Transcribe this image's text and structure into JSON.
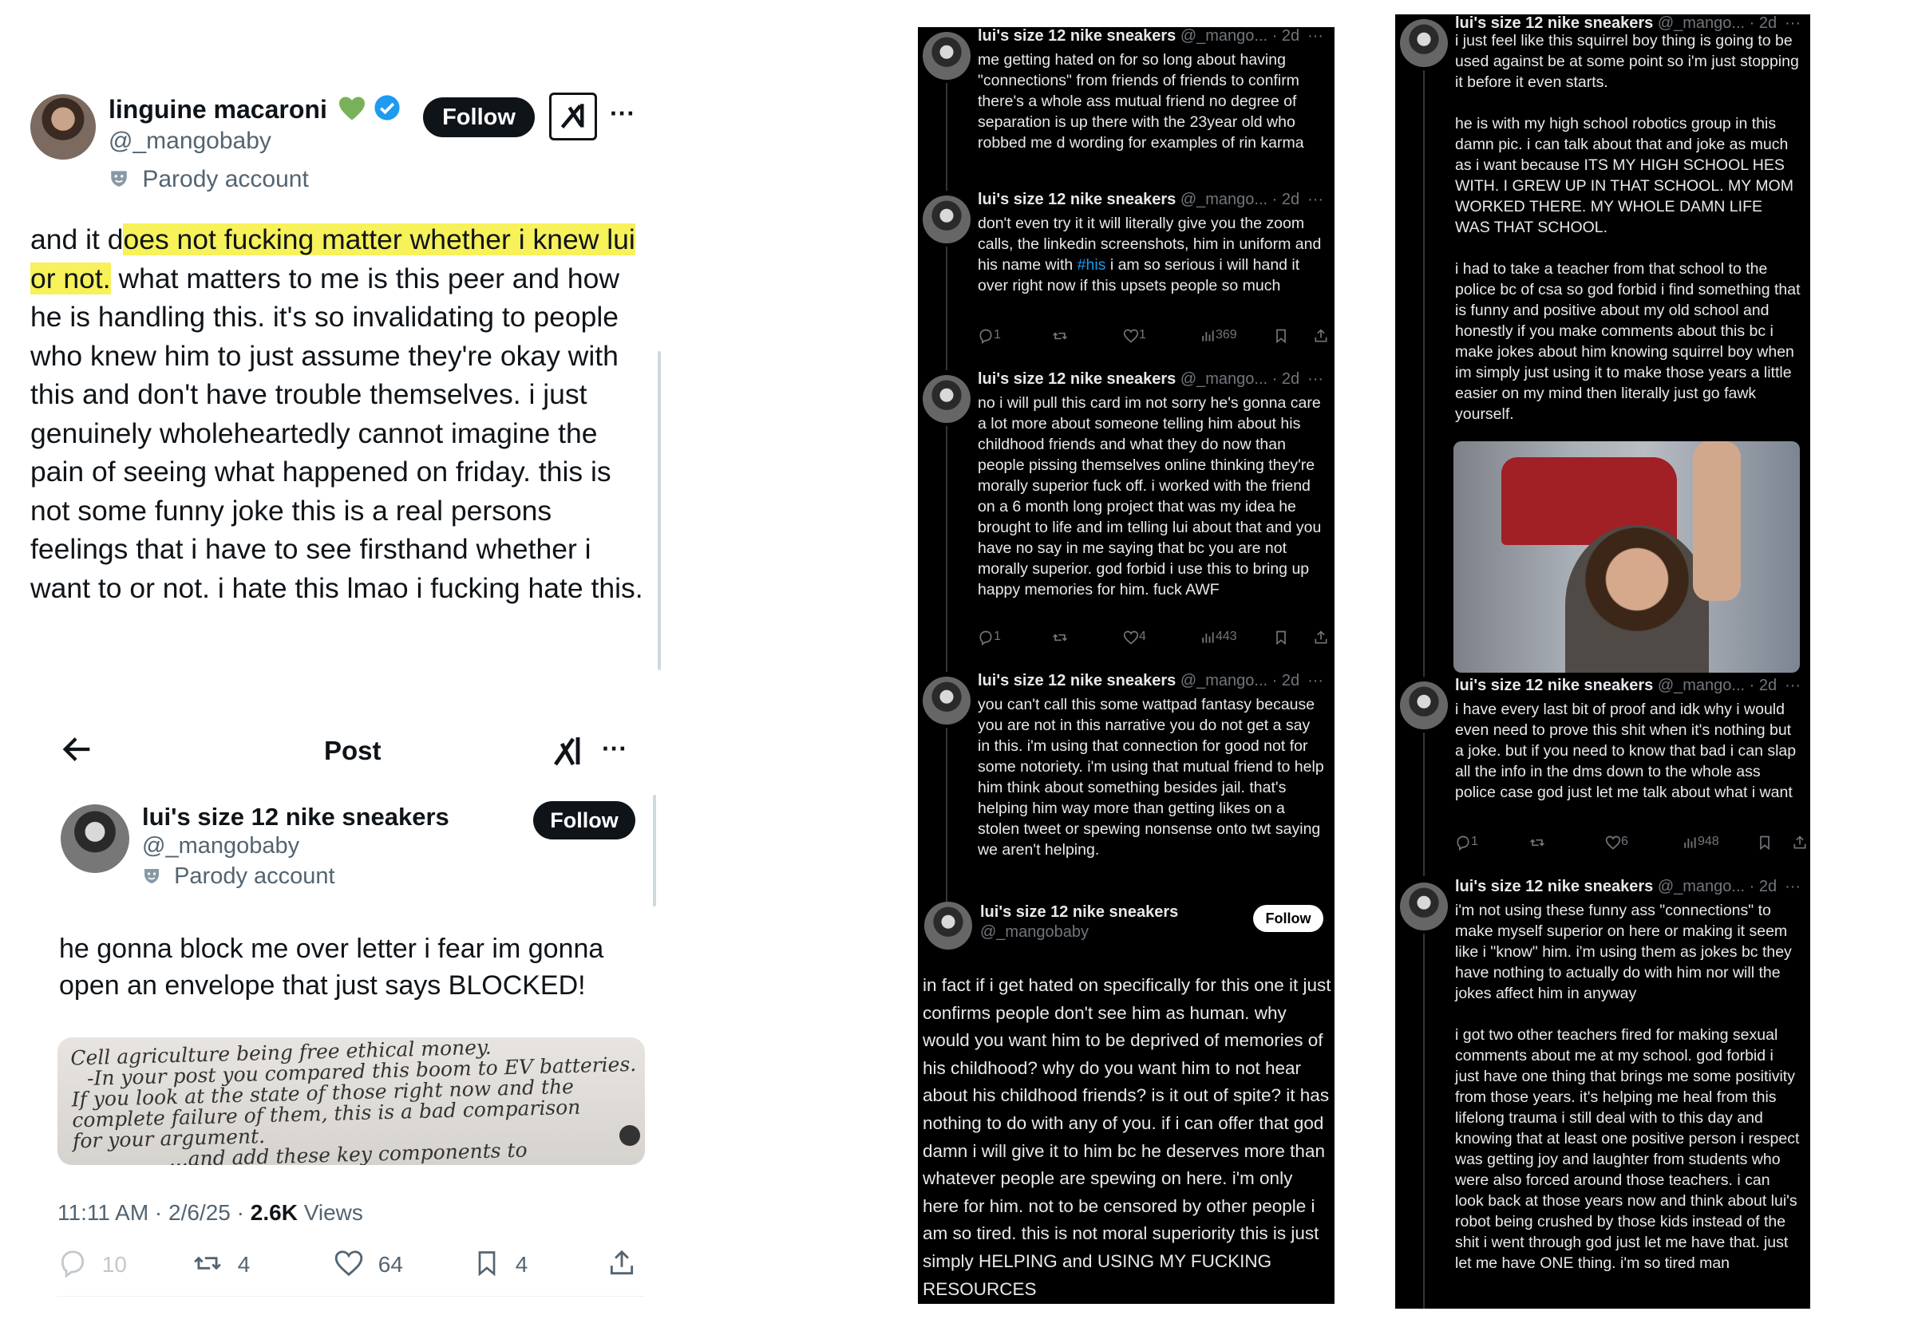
{
  "screenshot1": {
    "display_name": "linguine macaroni",
    "handle": "@_mangobaby",
    "parody_label": "Parody account",
    "follow_label": "Follow",
    "more_label": "···",
    "text_pre": "and it d",
    "text_highlight_1": "oes not fucking matter whether i knew lui",
    "text_highlight_2": "or not.",
    "text_post": " what matters to me is this peer and how he is handling this. it's so invalidating to people who knew him to just assume they're okay with this and don't have trouble themselves. i just genuinely wholeheartedly cannot imagine the pain of seeing what happened on friday. this is not some funny joke this is a real persons feelings that i have to see firsthand whether i want to or not. i hate this lmao i fucking hate this."
  },
  "screenshot2": {
    "header_title": "Post",
    "back_icon": "arrow-left-icon",
    "more_label": "···",
    "display_name": "lui's size 12 nike sneakers",
    "handle": "@_mangobaby",
    "parody_label": "Parody account",
    "follow_label": "Follow",
    "text": "he gonna block me over letter i fear im gonna open an envelope that just says BLOCKED!",
    "letter_lines": [
      "Cell agriculture being free ethical money.",
      "-In your post you compared this boom to EV batteries.",
      "If you look at the state of those right now and the",
      "complete failure of them, this is a bad comparison",
      "for your argument.",
      "...and add these key components to"
    ],
    "timestamp": "11:11 AM · 2/6/25 · ",
    "views_count": "2.6K",
    "views_label": " Views",
    "stats": {
      "replies": "10",
      "reposts": "4",
      "likes": "64",
      "bookmarks": "4"
    }
  },
  "panel3": {
    "tweets": [
      {
        "name": "lui's size 12 nike sneakers",
        "handle": "@_mango... · 2d",
        "text": "me getting hated on for so long about having \"connections\" from friends of friends to confirm there's a whole ass mutual friend no degree of separation is up there with the 23year old who robbed me d wording for examples of rin karma"
      },
      {
        "name": "lui's size 12 nike sneakers",
        "handle": "@_mango... · 2d",
        "text_a": "don't even try it it will literally give you the zoom calls, the linkedin screenshots, him in uniform and his name with ",
        "hashtag": "#his",
        "text_b": " i am so serious i will hand it over right now if this upsets people so much",
        "replies": "1",
        "likes": "1",
        "views": "369"
      },
      {
        "name": "lui's size 12 nike sneakers",
        "handle": "@_mango... · 2d",
        "text": "no i will pull this card im not sorry he's gonna care a lot more about someone telling him about his childhood friends and what they do now than people pissing themselves online thinking they're morally superior fuck off. i worked with the friend on a 6 month long project that was my idea he brought to life and im telling lui about that and you have no say in me saying that bc you are not morally superior. god forbid i use this to bring up happy memories for him. fuck AWF",
        "replies": "1",
        "likes": "4",
        "views": "443"
      },
      {
        "name": "lui's size 12 nike sneakers",
        "handle": "@_mango... · 2d",
        "text": "you can't call this some wattpad fantasy because you are not in this narrative you do not get a say in this. i'm using that connection for good not for some notoriety. i'm using that mutual friend to help him think about something besides jail. that's helping him way more than getting likes on a stolen tweet or spewing nonsense onto twt saying we aren't helping."
      }
    ],
    "bottom": {
      "name": "lui's size 12 nike sneakers",
      "handle": "@_mangobaby",
      "follow_label": "Follow",
      "text": "in fact if i get hated on specifically for this one it just confirms people don't see him as human. why would you want him to be deprived of memories of his childhood? why do you want him to not hear about his childhood friends? is it out of spite? it has nothing to do with any of you. if i can offer that god damn i will give it to him bc he deserves more than whatever people are spewing on here. i'm only here for him. not to be censored by other people i am so tired. this is not moral superiority this is just simply HELPING  and USING MY FUCKING RESOURCES"
    }
  },
  "panel4": {
    "tweets": [
      {
        "name": "lui's size 12 nike sneakers",
        "handle": "@_mango... · 2d",
        "text": "i just feel like this squirrel boy thing is going to be used against be at some point so i'm just stopping it before it even starts.\n\nhe is with my high school robotics group in this damn pic. i can talk about that and joke as much as i want because ITS MY HIGH SCHOOL HES WITH. I GREW UP IN THAT SCHOOL. MY MOM WORKED THERE. MY WHOLE DAMN LIFE WAS THAT SCHOOL.\n\ni had to take a teacher from that school to the police bc of csa so god forbid i find something that is funny and positive about my old school and honestly if you make comments about this bc i make jokes about him knowing squirrel boy when im simply just using it to make those years a little easier on my mind then literally just go fawk yourself."
      },
      {
        "name": "lui's size 12 nike sneakers",
        "handle": "@_mango... · 2d",
        "text": "i have every last bit of proof and idk why i would even need to prove this shit when it's nothing but a joke. but if you need to know that bad i can slap all the info in the dms down to the whole ass police case god just let me talk about what i want",
        "replies": "1",
        "likes": "6",
        "views": "948"
      },
      {
        "name": "lui's size 12 nike sneakers",
        "handle": "@_mango... · 2d",
        "text": "i'm not using these funny ass \"connections\" to make myself superior on here or making it seem like i \"know\" him. i'm using them as jokes bc they have nothing to actually do with him nor will the jokes affect him in anyway\n\ni got two other teachers fired for making sexual comments about me at my school. god forbid i just have one thing that brings me some positivity from those years. it's helping me heal from this lifelong trauma i still deal with to this day and knowing that at least one positive person i respect was getting joy and laughter from students who were also forced around those teachers. i can look back at those years now and think about lui's robot being crushed by those kids instead of the shit i went through god just let me have that. just let me have ONE thing. i'm so tired man"
      }
    ]
  },
  "colors": {
    "highlight": "#f7f15a",
    "verified": "#1d9bf0",
    "heart": "#00ba7c",
    "dark_bg": "#000000"
  }
}
